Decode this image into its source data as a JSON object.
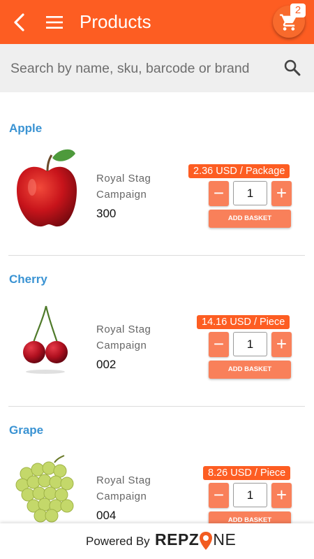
{
  "header": {
    "title": "Products",
    "cart_count": "2"
  },
  "search": {
    "placeholder": "Search by name, sku, barcode or brand"
  },
  "products": [
    {
      "name": "Apple",
      "campaign": "Royal Stag Campaign",
      "campaign_line1": "Royal Stag",
      "campaign_line2": "Campaign",
      "code": "300",
      "price": "2.36 USD / Package",
      "quantity": "1",
      "add_label": "ADD BASKET"
    },
    {
      "name": "Cherry",
      "campaign": "Royal Stag Campaign",
      "campaign_line1": "Royal Stag",
      "campaign_line2": "Campaign",
      "code": "002",
      "price": "14.16 USD / Piece",
      "quantity": "1",
      "add_label": "ADD BASKET"
    },
    {
      "name": "Grape",
      "campaign": "Royal Stag Campaign",
      "campaign_line1": "Royal Stag",
      "campaign_line2": "Campaign",
      "code": "004",
      "price": "8.26 USD / Piece",
      "quantity": "1",
      "add_label": "ADD BASKET"
    }
  ],
  "footer": {
    "powered_by": "Powered By",
    "brand": "REPZONE",
    "brand_left": "REPZ",
    "brand_right": "NE"
  },
  "icons": {
    "back": "back-arrow-icon",
    "menu": "hamburger-menu-icon",
    "cart": "shopping-cart-icon",
    "search": "search-icon"
  },
  "colors": {
    "primary": "#fd5d22",
    "button": "#f9805a",
    "name_link": "#3a93d3"
  }
}
